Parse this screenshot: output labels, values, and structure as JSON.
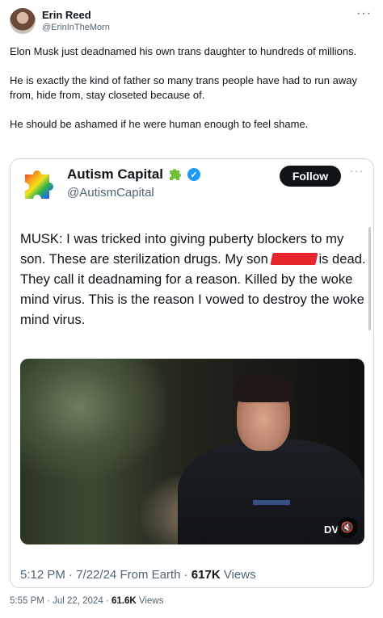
{
  "post": {
    "author_name": "Erin Reed",
    "author_handle": "@ErinInTheMorn",
    "more_label": "···",
    "paragraphs": [
      "Elon Musk just deadnamed his own trans daughter to hundreds of millions.",
      "He is exactly the kind of father so many trans people have had to run away from, hide from, stay closeted because of.",
      "He should be ashamed if he were human enough to feel shame."
    ],
    "time": "5:55 PM",
    "date": "Jul 22, 2024",
    "views_count": "61.6K",
    "views_label": "Views"
  },
  "quoted": {
    "author_name": "Autism Capital",
    "author_handle": "@AutismCapital",
    "follow_label": "Follow",
    "more_label": "···",
    "text_before_redaction": "MUSK: I was tricked into giving puberty blockers to my son. These are sterilization drugs. My son ",
    "text_after_redaction": "is dead. They call it deadnaming for a reason. Killed by the woke mind virus. This is the reason I vowed to destroy the woke mind virus.",
    "video_watermark": "DV",
    "mute_icon": "🔇",
    "time": "5:12 PM",
    "date": "7/22/24",
    "source": "From Earth",
    "views_count": "617K",
    "views_label": "Views"
  },
  "colors": {
    "text": "#0f1419",
    "secondary": "#536471",
    "verified": "#1d9bf0",
    "border": "#cfd9de",
    "redaction": "#e8262d"
  }
}
